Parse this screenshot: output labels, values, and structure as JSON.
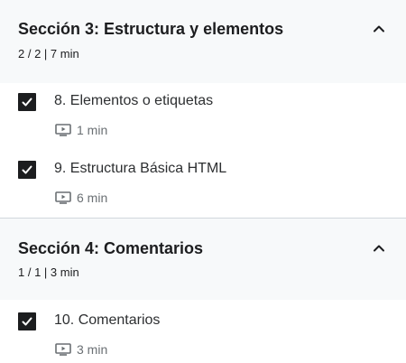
{
  "sections": [
    {
      "title": "Sección 3: Estructura y elementos",
      "meta": "2 / 2 | 7 min",
      "lectures": [
        {
          "title": "8. Elementos o etiquetas",
          "duration": "1 min",
          "completed": true
        },
        {
          "title": "9. Estructura Básica HTML",
          "duration": "6 min",
          "completed": true
        }
      ]
    },
    {
      "title": "Sección 4: Comentarios",
      "meta": "1 / 1 | 3 min",
      "lectures": [
        {
          "title": "10. Comentarios",
          "duration": "3 min",
          "completed": true
        }
      ]
    }
  ],
  "icons": {
    "chevron": "chevron-up-icon",
    "check": "check-icon",
    "video": "video-icon"
  },
  "colors": {
    "header_bg": "#f7f9fa",
    "checkbox": "#1c1d1f",
    "muted_text": "#6a6f73",
    "divider": "#d1d7dc"
  }
}
